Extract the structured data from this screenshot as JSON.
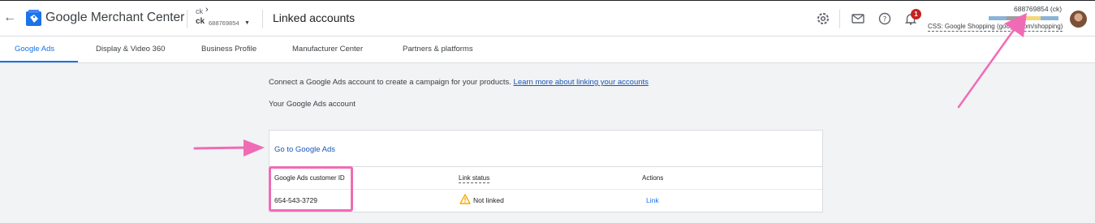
{
  "header": {
    "back_icon": "arrow-back-icon",
    "app_title_google": "Google",
    "app_title_rest": " Merchant Center",
    "account_small": "ck",
    "account_name": "ck",
    "account_id": "688769854",
    "page_title": "Linked accounts",
    "notification_count": "1",
    "right_account_id": "688769854 (ck)",
    "css_label": "CSS: Google Shopping (google.com/shopping)"
  },
  "tabs": [
    {
      "label": "Google Ads",
      "active": true
    },
    {
      "label": "Display & Video 360",
      "active": false
    },
    {
      "label": "Business Profile",
      "active": false
    },
    {
      "label": "Manufacturer Center",
      "active": false
    },
    {
      "label": "Partners & platforms",
      "active": false
    }
  ],
  "main": {
    "intro_text": "Connect a Google Ads account to create a campaign for your products.",
    "learn_more": "Learn more about linking your accounts",
    "subheading": "Your Google Ads account",
    "card": {
      "goto_link": "Go to Google Ads",
      "columns": [
        "Google Ads customer ID",
        "Link status",
        "Actions"
      ],
      "row": {
        "customer_id": "654-543-3729",
        "status": "Not linked",
        "action": "Link"
      }
    }
  },
  "colors": {
    "accent": "#1a73e8",
    "annotation": "#f06bb5",
    "badge": "#c5221f",
    "warning": "#f9ab00"
  }
}
